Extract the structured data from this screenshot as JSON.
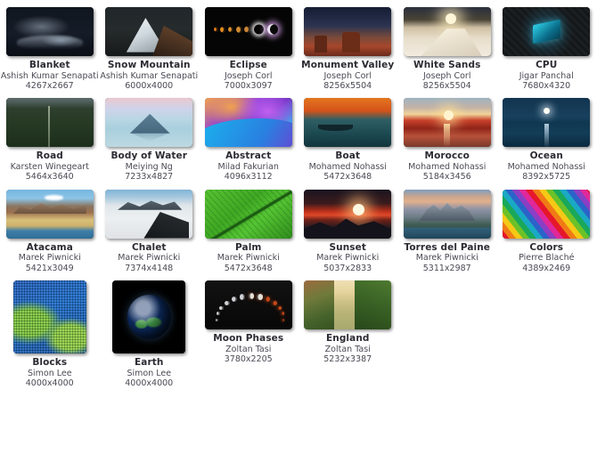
{
  "gallery": {
    "items": [
      {
        "title": "Blanket",
        "author": "Ashish Kumar Senapati",
        "dimensions": "4267x2667",
        "art": "art-blanket",
        "shape": "wide"
      },
      {
        "title": "Snow Mountain",
        "author": "Ashish Kumar Senapati",
        "dimensions": "6000x4000",
        "art": "art-snow",
        "shape": "wide"
      },
      {
        "title": "Eclipse",
        "author": "Joseph Corl",
        "dimensions": "7000x3097",
        "art": "art-eclipse",
        "shape": "wide"
      },
      {
        "title": "Monument Valley",
        "author": "Joseph Corl",
        "dimensions": "8256x5504",
        "art": "art-monument",
        "shape": "wide"
      },
      {
        "title": "White Sands",
        "author": "Joseph Corl",
        "dimensions": "8256x5504",
        "art": "art-whitesands",
        "shape": "wide"
      },
      {
        "title": "CPU",
        "author": "Jigar Panchal",
        "dimensions": "7680x4320",
        "art": "art-cpu",
        "shape": "wide"
      },
      {
        "title": "Road",
        "author": "Karsten Winegeart",
        "dimensions": "5464x3640",
        "art": "art-road",
        "shape": "wide"
      },
      {
        "title": "Body of Water",
        "author": "Meiying Ng",
        "dimensions": "7233x4827",
        "art": "art-water",
        "shape": "wide"
      },
      {
        "title": "Abstract",
        "author": "Milad Fakurian",
        "dimensions": "4096x3112",
        "art": "art-abstract",
        "shape": "wide"
      },
      {
        "title": "Boat",
        "author": "Mohamed Nohassi",
        "dimensions": "5472x3648",
        "art": "art-boat",
        "shape": "wide"
      },
      {
        "title": "Morocco",
        "author": "Mohamed Nohassi",
        "dimensions": "5184x3456",
        "art": "art-morocco",
        "shape": "wide"
      },
      {
        "title": "Ocean",
        "author": "Mohamed Nohassi",
        "dimensions": "8392x5725",
        "art": "art-ocean",
        "shape": "wide"
      },
      {
        "title": "Atacama",
        "author": "Marek Piwnicki",
        "dimensions": "5421x3049",
        "art": "art-atacama",
        "shape": "wide"
      },
      {
        "title": "Chalet",
        "author": "Marek Piwnicki",
        "dimensions": "7374x4148",
        "art": "art-chalet",
        "shape": "wide"
      },
      {
        "title": "Palm",
        "author": "Marek Piwnicki",
        "dimensions": "5472x3648",
        "art": "art-palm",
        "shape": "wide"
      },
      {
        "title": "Sunset",
        "author": "Marek Piwnicki",
        "dimensions": "5037x2833",
        "art": "art-sunset",
        "shape": "wide"
      },
      {
        "title": "Torres del Paine",
        "author": "Marek Piwnicki",
        "dimensions": "5311x2987",
        "art": "art-torres",
        "shape": "wide"
      },
      {
        "title": "Colors",
        "author": "Pierre Blaché",
        "dimensions": "4389x2469",
        "art": "art-colors",
        "shape": "wide"
      },
      {
        "title": "Blocks",
        "author": "Simon Lee",
        "dimensions": "4000x4000",
        "art": "art-blocks",
        "shape": "square"
      },
      {
        "title": "Earth",
        "author": "Simon Lee",
        "dimensions": "4000x4000",
        "art": "art-earth",
        "shape": "square"
      },
      {
        "title": "Moon Phases",
        "author": "Zoltan Tasi",
        "dimensions": "3780x2205",
        "art": "art-moonphases",
        "shape": "wide"
      },
      {
        "title": "England",
        "author": "Zoltan Tasi",
        "dimensions": "5232x3387",
        "art": "art-england",
        "shape": "wide"
      }
    ]
  },
  "colors": {
    "background": "#ffffff",
    "title_text": "#2b2b33",
    "meta_text": "#4a4a54"
  }
}
